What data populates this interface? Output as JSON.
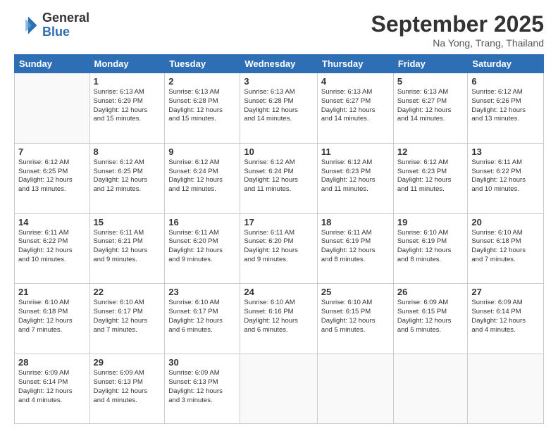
{
  "logo": {
    "general": "General",
    "blue": "Blue"
  },
  "title": "September 2025",
  "location": "Na Yong, Trang, Thailand",
  "days_of_week": [
    "Sunday",
    "Monday",
    "Tuesday",
    "Wednesday",
    "Thursday",
    "Friday",
    "Saturday"
  ],
  "weeks": [
    [
      {
        "num": "",
        "info": ""
      },
      {
        "num": "1",
        "info": "Sunrise: 6:13 AM\nSunset: 6:29 PM\nDaylight: 12 hours\nand 15 minutes."
      },
      {
        "num": "2",
        "info": "Sunrise: 6:13 AM\nSunset: 6:28 PM\nDaylight: 12 hours\nand 15 minutes."
      },
      {
        "num": "3",
        "info": "Sunrise: 6:13 AM\nSunset: 6:28 PM\nDaylight: 12 hours\nand 14 minutes."
      },
      {
        "num": "4",
        "info": "Sunrise: 6:13 AM\nSunset: 6:27 PM\nDaylight: 12 hours\nand 14 minutes."
      },
      {
        "num": "5",
        "info": "Sunrise: 6:13 AM\nSunset: 6:27 PM\nDaylight: 12 hours\nand 14 minutes."
      },
      {
        "num": "6",
        "info": "Sunrise: 6:12 AM\nSunset: 6:26 PM\nDaylight: 12 hours\nand 13 minutes."
      }
    ],
    [
      {
        "num": "7",
        "info": "Sunrise: 6:12 AM\nSunset: 6:25 PM\nDaylight: 12 hours\nand 13 minutes."
      },
      {
        "num": "8",
        "info": "Sunrise: 6:12 AM\nSunset: 6:25 PM\nDaylight: 12 hours\nand 12 minutes."
      },
      {
        "num": "9",
        "info": "Sunrise: 6:12 AM\nSunset: 6:24 PM\nDaylight: 12 hours\nand 12 minutes."
      },
      {
        "num": "10",
        "info": "Sunrise: 6:12 AM\nSunset: 6:24 PM\nDaylight: 12 hours\nand 11 minutes."
      },
      {
        "num": "11",
        "info": "Sunrise: 6:12 AM\nSunset: 6:23 PM\nDaylight: 12 hours\nand 11 minutes."
      },
      {
        "num": "12",
        "info": "Sunrise: 6:12 AM\nSunset: 6:23 PM\nDaylight: 12 hours\nand 11 minutes."
      },
      {
        "num": "13",
        "info": "Sunrise: 6:11 AM\nSunset: 6:22 PM\nDaylight: 12 hours\nand 10 minutes."
      }
    ],
    [
      {
        "num": "14",
        "info": "Sunrise: 6:11 AM\nSunset: 6:22 PM\nDaylight: 12 hours\nand 10 minutes."
      },
      {
        "num": "15",
        "info": "Sunrise: 6:11 AM\nSunset: 6:21 PM\nDaylight: 12 hours\nand 9 minutes."
      },
      {
        "num": "16",
        "info": "Sunrise: 6:11 AM\nSunset: 6:20 PM\nDaylight: 12 hours\nand 9 minutes."
      },
      {
        "num": "17",
        "info": "Sunrise: 6:11 AM\nSunset: 6:20 PM\nDaylight: 12 hours\nand 9 minutes."
      },
      {
        "num": "18",
        "info": "Sunrise: 6:11 AM\nSunset: 6:19 PM\nDaylight: 12 hours\nand 8 minutes."
      },
      {
        "num": "19",
        "info": "Sunrise: 6:10 AM\nSunset: 6:19 PM\nDaylight: 12 hours\nand 8 minutes."
      },
      {
        "num": "20",
        "info": "Sunrise: 6:10 AM\nSunset: 6:18 PM\nDaylight: 12 hours\nand 7 minutes."
      }
    ],
    [
      {
        "num": "21",
        "info": "Sunrise: 6:10 AM\nSunset: 6:18 PM\nDaylight: 12 hours\nand 7 minutes."
      },
      {
        "num": "22",
        "info": "Sunrise: 6:10 AM\nSunset: 6:17 PM\nDaylight: 12 hours\nand 7 minutes."
      },
      {
        "num": "23",
        "info": "Sunrise: 6:10 AM\nSunset: 6:17 PM\nDaylight: 12 hours\nand 6 minutes."
      },
      {
        "num": "24",
        "info": "Sunrise: 6:10 AM\nSunset: 6:16 PM\nDaylight: 12 hours\nand 6 minutes."
      },
      {
        "num": "25",
        "info": "Sunrise: 6:10 AM\nSunset: 6:15 PM\nDaylight: 12 hours\nand 5 minutes."
      },
      {
        "num": "26",
        "info": "Sunrise: 6:09 AM\nSunset: 6:15 PM\nDaylight: 12 hours\nand 5 minutes."
      },
      {
        "num": "27",
        "info": "Sunrise: 6:09 AM\nSunset: 6:14 PM\nDaylight: 12 hours\nand 4 minutes."
      }
    ],
    [
      {
        "num": "28",
        "info": "Sunrise: 6:09 AM\nSunset: 6:14 PM\nDaylight: 12 hours\nand 4 minutes."
      },
      {
        "num": "29",
        "info": "Sunrise: 6:09 AM\nSunset: 6:13 PM\nDaylight: 12 hours\nand 4 minutes."
      },
      {
        "num": "30",
        "info": "Sunrise: 6:09 AM\nSunset: 6:13 PM\nDaylight: 12 hours\nand 3 minutes."
      },
      {
        "num": "",
        "info": ""
      },
      {
        "num": "",
        "info": ""
      },
      {
        "num": "",
        "info": ""
      },
      {
        "num": "",
        "info": ""
      }
    ]
  ]
}
